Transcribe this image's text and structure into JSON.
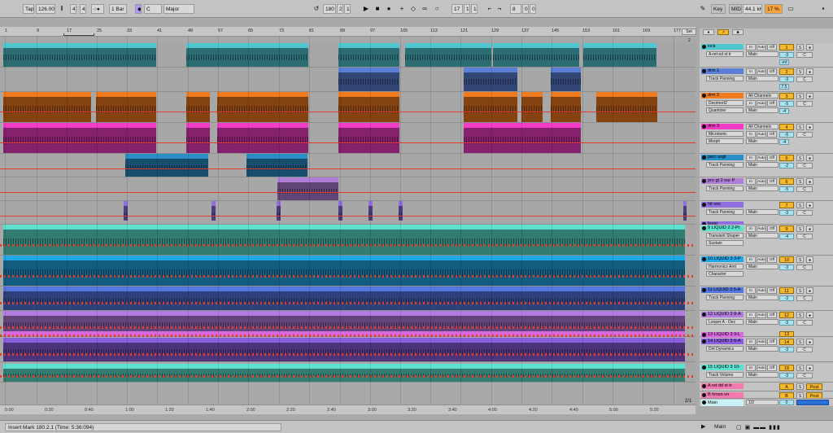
{
  "toolbar": {
    "tap": "Tap",
    "tempo": "126.00",
    "sig_num": "4",
    "sig_den": "4",
    "metro": "○●",
    "quant": "1 Bar",
    "key": "C",
    "scale": "Major",
    "pos_bar": "180",
    "pos_beat": "2",
    "pos_sixteenth": "1",
    "loop_start": "17",
    "loop_beat": "1",
    "loop_sixteenth": "1",
    "loop_len_bar": "8",
    "loop_len_beat": "0",
    "loop_len_sixteenth": "0",
    "key_label": "Key",
    "midi_label": "MIDI",
    "sample_rate": "44.1 kHz",
    "cpu": "17 %"
  },
  "ruler": {
    "bars": [
      "1",
      "9",
      "17",
      "25",
      "33",
      "41",
      "49",
      "57",
      "65",
      "73",
      "81",
      "89",
      "97",
      "105",
      "113",
      "121",
      "129",
      "137",
      "145",
      "153",
      "161",
      "169",
      "177"
    ],
    "set_label": "Set",
    "page_count": "2"
  },
  "time_axis": {
    "labels": [
      "0:00",
      "0:20",
      "0:40",
      "1:00",
      "1:20",
      "1:40",
      "2:00",
      "2:20",
      "2:40",
      "3:00",
      "3:20",
      "3:40",
      "4:00",
      "4:20",
      "4:40",
      "5:00",
      "5:20"
    ],
    "zoom_label": "2/1"
  },
  "tracks": [
    {
      "name": "kick",
      "color": "#4fc7d0",
      "device": "A-ret-od st tr",
      "out": "Main",
      "num": "1",
      "vol": "-3",
      "pan": "C",
      "sends": [
        "-inf"
      ],
      "mon": [
        "In",
        "Auto",
        "Off"
      ]
    },
    {
      "name": "drm 1",
      "color": "#5b7fd6",
      "device": "Track Panning",
      "out": "Main",
      "num": "2",
      "vol": "-3",
      "pan": "C",
      "sends": [
        "7.5"
      ],
      "mon": [
        "In",
        "Auto",
        "Off"
      ]
    },
    {
      "name": "drm 2",
      "color": "#f07a1e",
      "device": "Decimort2",
      "device2": "Quantizer",
      "out": "Main",
      "num": "3",
      "vol": "-5",
      "pan": "C",
      "sends": [
        "-4"
      ],
      "mon": [
        "In",
        "Auto",
        "Off"
      ],
      "input": "All Channels"
    },
    {
      "name": "drm 3",
      "color": "#f23cc7",
      "device": "Microtonic",
      "device2": "Morph",
      "out": "Main",
      "num": "4",
      "vol": "-6",
      "pan": "C",
      "sends": [
        "-4"
      ],
      "mon": [
        "In",
        "Auto",
        "Off"
      ],
      "input": "All Channels"
    },
    {
      "name": "perc sngl",
      "color": "#2a8ec7",
      "device": "Track Panning",
      "out": "Main",
      "num": "5",
      "vol": "-2",
      "pan": "C",
      "sends": [],
      "mon": [
        "In",
        "Auto",
        "Off"
      ]
    },
    {
      "name": "pro gt 2 our P",
      "color": "#b07ed6",
      "device": "Track Panning",
      "out": "Main",
      "num": "6",
      "vol": "-5",
      "pan": "C",
      "sends": [],
      "mon": [
        "In",
        "Auto",
        "Off"
      ]
    },
    {
      "name": "hit vox",
      "color": "#8e6ee0",
      "device": "Track Panning",
      "out": "Main",
      "num": "7",
      "vol": "-3",
      "pan": "C",
      "sends": [],
      "mon": []
    },
    {
      "name": "boop",
      "color": "#8e6ee0",
      "device": "",
      "out": "",
      "num": "",
      "vol": "",
      "pan": "",
      "sends": [],
      "mon": []
    },
    {
      "name": "9 LIQUID 2 2-Pt",
      "color": "#5de2d0",
      "device": "Transient Shaper",
      "device2": "Sustain",
      "out": "Main",
      "num": "9",
      "vol": "-4",
      "pan": "C",
      "sends": [],
      "mon": [
        "In",
        "Auto",
        "Off"
      ]
    },
    {
      "name": "10 LIQUID 3 3-P",
      "color": "#1fa8e6",
      "device": "Harmonics Amt",
      "device2": "Character",
      "out": "Main",
      "num": "10",
      "vol": "-3",
      "pan": "C",
      "sends": [],
      "mon": [
        "In",
        "Auto",
        "Off"
      ]
    },
    {
      "name": "11 LIQUID 3 5-A",
      "color": "#5577dd",
      "device": "Track Panning",
      "out": "Main",
      "num": "11",
      "vol": "-3",
      "pan": "C",
      "sends": [],
      "mon": [
        "In",
        "Auto",
        "Off"
      ]
    },
    {
      "name": "12 LIQUID 3 8-A",
      "color": "#b27ce0",
      "device": "Looper A - Dec",
      "out": "Main",
      "num": "12",
      "vol": "-3",
      "pan": "C",
      "sends": [],
      "mon": [
        "In",
        "Auto",
        "Off"
      ]
    },
    {
      "name": "13 LIQUID 3 9-L",
      "color": "#d86ae0",
      "device": "",
      "out": "",
      "num": "13",
      "vol": "",
      "pan": "",
      "sends": [],
      "mon": []
    },
    {
      "name": "14 LIQUID 3 6-A",
      "color": "#8a5fe0",
      "device": "Dirt Dynamics",
      "out": "Main",
      "num": "14",
      "vol": "-3",
      "pan": "C",
      "sends": [],
      "mon": [
        "In",
        "Auto",
        "Off"
      ]
    },
    {
      "name": "15 LIQUID 3 10-",
      "color": "#5de2d0",
      "device": "Track Volume",
      "out": "Main",
      "num": "15",
      "vol": "-3",
      "pan": "C",
      "sends": [],
      "mon": [
        "In",
        "Auto",
        "Off"
      ]
    }
  ],
  "returns": [
    {
      "name": "A ret dd st tr",
      "color": "#f27ab0",
      "num": "A",
      "post": "Post"
    },
    {
      "name": "B hmsn vrr",
      "color": "#f27ab0",
      "num": "B",
      "post": "Post"
    }
  ],
  "master": {
    "name": "Main",
    "out": "1/2",
    "vol": "0"
  },
  "status": {
    "message": "Insert Mark 180.2.1 (Time: 5:36:094)",
    "main_label": "Main"
  },
  "colors": {
    "kick": "#4fc7d0",
    "drum_blue": "#5b7fd6",
    "orange": "#f07a1e",
    "pink": "#f23cc7",
    "automation": "#e33b2e",
    "track_num": "#f7b82b"
  }
}
